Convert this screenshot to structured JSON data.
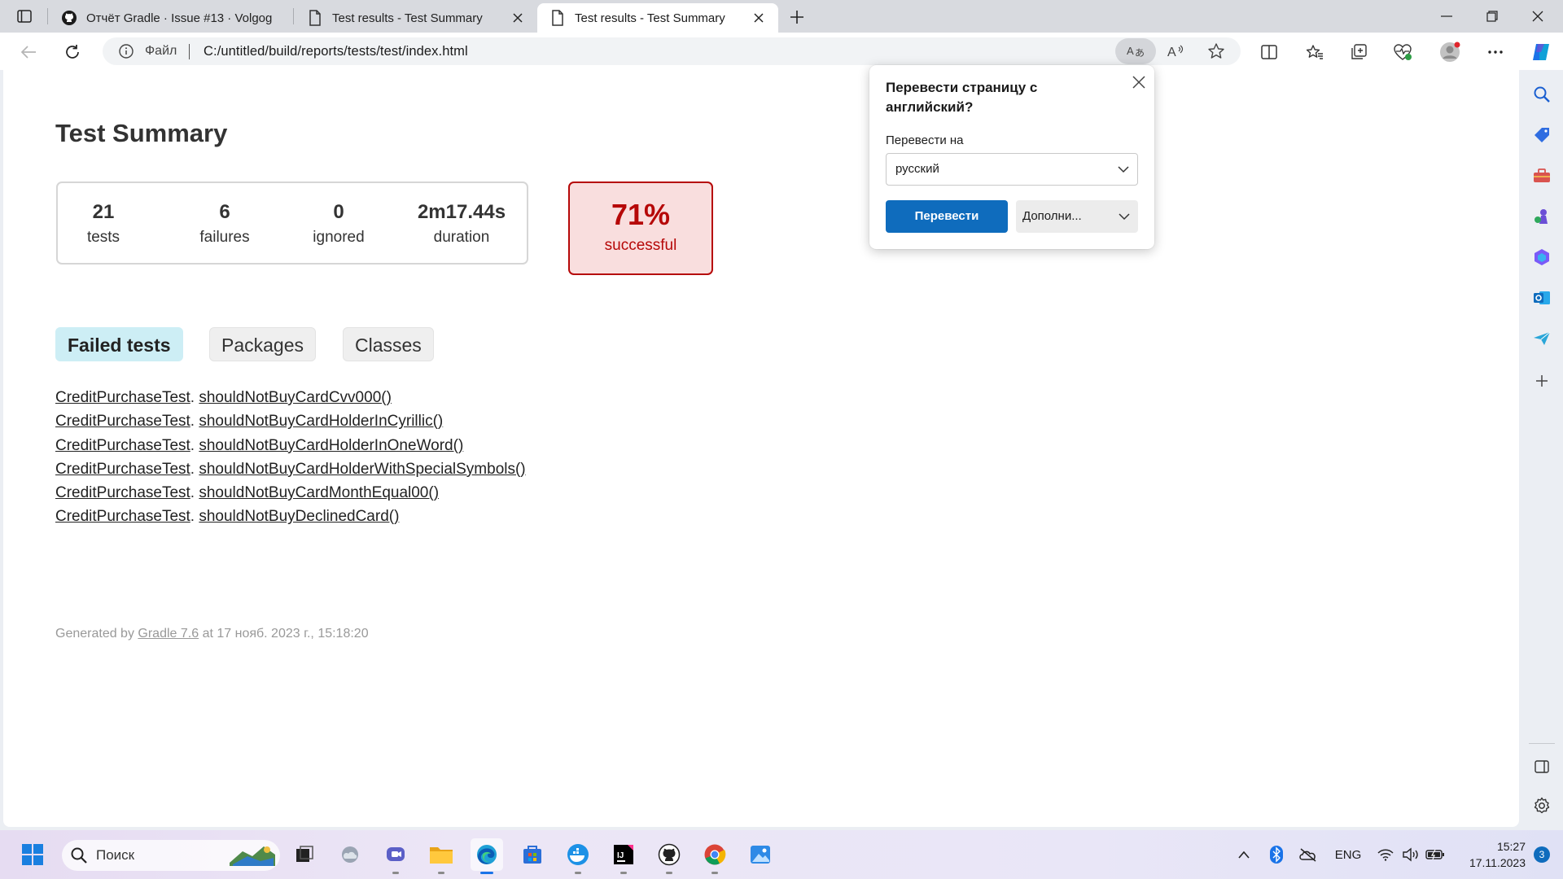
{
  "browser": {
    "tabs": [
      {
        "title": "Отчёт Gradle · Issue #13 · Volgog",
        "active": false,
        "icon": "github-icon"
      },
      {
        "title": "Test results - Test Summary",
        "active": false,
        "icon": "page-icon"
      },
      {
        "title": "Test results - Test Summary",
        "active": true,
        "icon": "page-icon"
      }
    ],
    "address": {
      "scheme_label": "Файл",
      "url": "C:/untitled/build/reports/tests/test/index.html"
    }
  },
  "page": {
    "title": "Test Summary",
    "summary": {
      "tests": {
        "value": "21",
        "label": "tests"
      },
      "failures": {
        "value": "6",
        "label": "failures"
      },
      "ignored": {
        "value": "0",
        "label": "ignored"
      },
      "duration": {
        "value": "2m17.44s",
        "label": "duration"
      }
    },
    "success_rate": {
      "value": "71%",
      "label": "successful",
      "color": "#b60808",
      "background": "#f9dede"
    },
    "tabs": [
      {
        "label": "Failed tests",
        "selected": true
      },
      {
        "label": "Packages",
        "selected": false
      },
      {
        "label": "Classes",
        "selected": false
      }
    ],
    "failed_tests": [
      {
        "class": "CreditPurchaseTest",
        "method": "shouldNotBuyCardCvv000()"
      },
      {
        "class": "CreditPurchaseTest",
        "method": "shouldNotBuyCardHolderInCyrillic()"
      },
      {
        "class": "CreditPurchaseTest",
        "method": "shouldNotBuyCardHolderInOneWord()"
      },
      {
        "class": "CreditPurchaseTest",
        "method": "shouldNotBuyCardHolderWithSpecialSymbols()"
      },
      {
        "class": "CreditPurchaseTest",
        "method": "shouldNotBuyCardMonthEqual00()"
      },
      {
        "class": "CreditPurchaseTest",
        "method": "shouldNotBuyDeclinedCard()"
      }
    ],
    "footer": {
      "prefix": "Generated by ",
      "link": "Gradle 7.6",
      "suffix": " at 17 нояб. 2023 г., 15:18:20"
    }
  },
  "translate_popup": {
    "title": "Перевести страницу с английский?",
    "target_label": "Перевести на",
    "target_value": "русский",
    "translate_button": "Перевести",
    "more_button": "Дополни...",
    "accent": "#0f6cbd"
  },
  "taskbar": {
    "search_placeholder": "Поиск",
    "language": "ENG",
    "time": "15:27",
    "date": "17.11.2023",
    "notifications": "3"
  }
}
